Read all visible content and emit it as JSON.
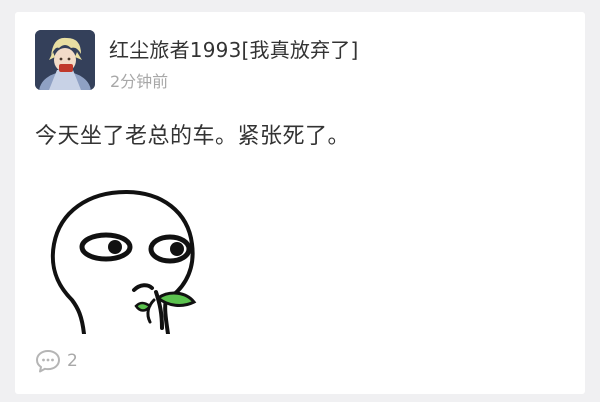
{
  "post": {
    "author": {
      "name": "红尘旅者1993[我真放弃了]",
      "avatar_icon": "avatar-image"
    },
    "time": "2分钟前",
    "text": "今天坐了老总的车。紧张死了。",
    "sticker_icon": "nervous-face-sticker",
    "comments": {
      "icon": "comment-bubble-icon",
      "count": "2"
    }
  }
}
